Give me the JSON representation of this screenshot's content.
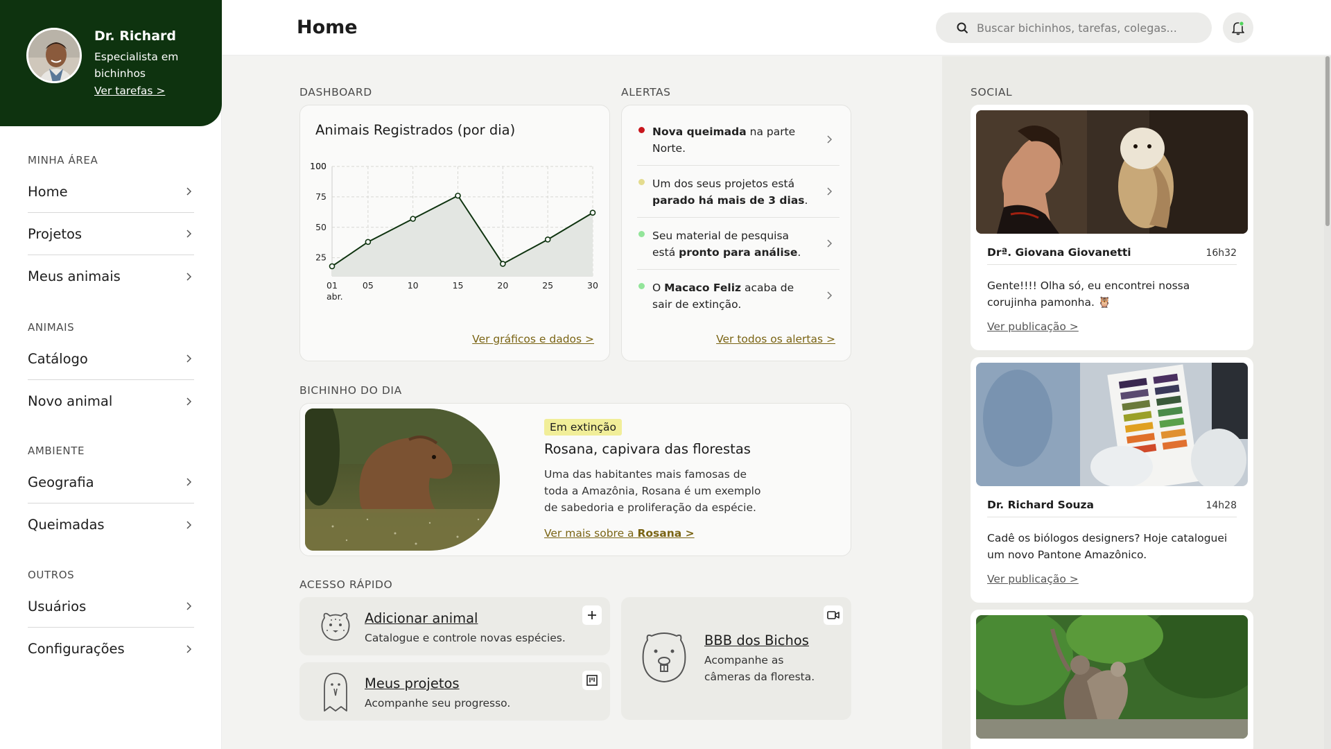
{
  "profile": {
    "name": "Dr. Richard",
    "role": "Especialista em bichinhos",
    "link": "Ver tarefas >"
  },
  "sidebar": {
    "sections": [
      {
        "title": "MINHA ÁREA",
        "items": [
          "Home",
          "Projetos",
          "Meus animais"
        ]
      },
      {
        "title": "ANIMAIS",
        "items": [
          "Catálogo",
          "Novo animal"
        ]
      },
      {
        "title": "AMBIENTE",
        "items": [
          "Geografia",
          "Queimadas"
        ]
      },
      {
        "title": "OUTROS",
        "items": [
          "Usuários",
          "Configurações"
        ]
      }
    ]
  },
  "header": {
    "title": "Home",
    "search_placeholder": "Buscar bichinhos, tarefas, colegas..."
  },
  "dashboard": {
    "label": "DASHBOARD",
    "link": "Ver gráficos e dados >"
  },
  "chart_data": {
    "type": "area",
    "title": "Animais Registrados (por dia)",
    "x": [
      1,
      5,
      10,
      15,
      20,
      25,
      30
    ],
    "x_tick_labels": [
      "01",
      "05",
      "10",
      "15",
      "20",
      "25",
      "30"
    ],
    "x_sublabel": "abr.",
    "values": [
      18,
      38,
      57,
      76,
      20,
      40,
      62
    ],
    "y_ticks": [
      25,
      50,
      75,
      100
    ],
    "ylim": [
      10,
      100
    ],
    "xlim": [
      1,
      30
    ],
    "grid": true,
    "colors": {
      "line": "#0e330f",
      "fill": "#e3e6e2"
    }
  },
  "alerts": {
    "label": "ALERTAS",
    "items": [
      {
        "color": "#c8161d",
        "bold1": "Nova queimada",
        "text1": " na parte Norte.",
        "bold2": "",
        "text2": ""
      },
      {
        "color": "#e4dc8f",
        "bold1": "",
        "text1": "Um dos seus projetos está ",
        "bold2": "parado há mais de 3 dias",
        "text2": "."
      },
      {
        "color": "#93e59a",
        "bold1": "",
        "text1": "Seu material de pesquisa está ",
        "bold2": "pronto para análise",
        "text2": "."
      },
      {
        "color": "#93e59a",
        "bold1": "",
        "text1": "O ",
        "bold2": "Macaco Feliz",
        "text2": " acaba de sair de extinção."
      }
    ],
    "link": "Ver todos os alertas >"
  },
  "featured": {
    "label": "BICHINHO DO DIA",
    "badge": "Em extinção",
    "title": "Rosana, capivara das florestas",
    "description": "Uma das habitantes mais famosas de toda a Amazônia, Rosana é um exemplo de sabedoria e proliferação da espécie.",
    "link_prefix": "Ver mais sobre a ",
    "link_name": "Rosana >"
  },
  "quick_access": {
    "label": "ACESSO RÁPIDO",
    "cards": [
      {
        "title": "Adicionar animal",
        "desc": "Catalogue e controle novas espécies.",
        "icon": "plus-icon"
      },
      {
        "title": "Meus projetos",
        "desc": "Acompanhe seu progresso.",
        "icon": "kanban-icon"
      },
      {
        "title": "BBB dos Bichos",
        "desc": "Acompanhe as câmeras da floresta.",
        "icon": "video-camera-icon"
      }
    ]
  },
  "social": {
    "label": "SOCIAL",
    "posts": [
      {
        "author": "Drª. Giovana Giovanetti",
        "time": "16h32",
        "text": "Gente!!!! Olha só, eu encontrei nossa corujinha pamonha. 🦉",
        "link": "Ver publicação >"
      },
      {
        "author": "Dr. Richard Souza",
        "time": "14h28",
        "text": "Cadê os biólogos designers? Hoje cataloguei um novo Pantone Amazônico.",
        "link": "Ver publicação >"
      }
    ]
  }
}
